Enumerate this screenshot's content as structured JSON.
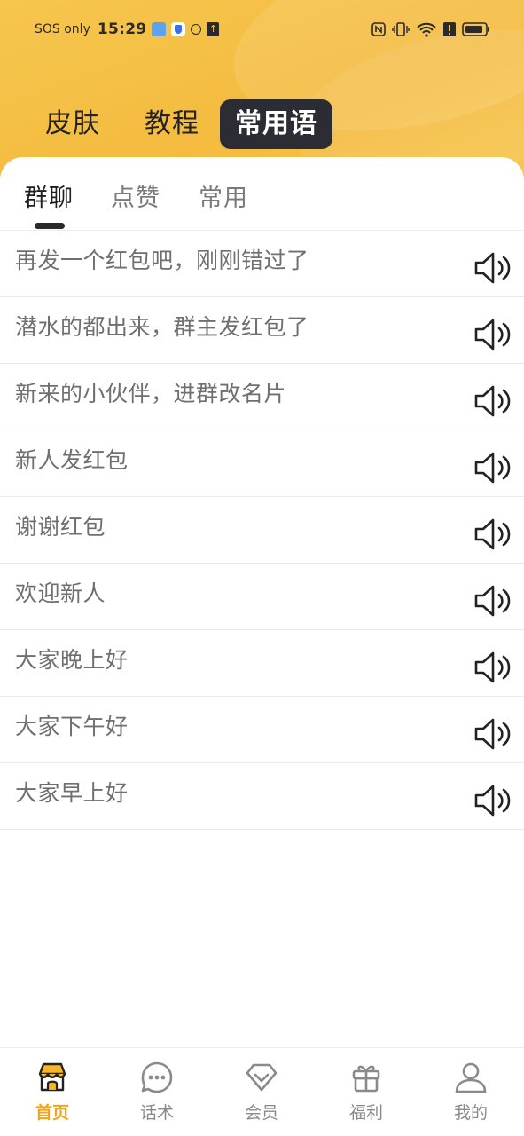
{
  "status_bar": {
    "carrier": "SOS only",
    "time": "15:29"
  },
  "top_tabs": [
    {
      "label": "皮肤"
    },
    {
      "label": "教程"
    },
    {
      "label": "常用语"
    }
  ],
  "active_top_tab": "常用语",
  "sub_tabs": [
    {
      "label": "群聊"
    },
    {
      "label": "点赞"
    },
    {
      "label": "常用"
    }
  ],
  "active_sub_tab": "群聊",
  "phrases": [
    {
      "text": "再发一个红包吧，刚刚错过了",
      "icon": "speaker-icon"
    },
    {
      "text": "潜水的都出来，群主发红包了",
      "icon": "speaker-icon"
    },
    {
      "text": "新来的小伙伴，进群改名片",
      "icon": "speaker-icon"
    },
    {
      "text": "新人发红包",
      "icon": "speaker-icon"
    },
    {
      "text": "谢谢红包",
      "icon": "speaker-icon"
    },
    {
      "text": "欢迎新人",
      "icon": "speaker-icon"
    },
    {
      "text": "大家晚上好",
      "icon": "speaker-icon"
    },
    {
      "text": "大家下午好",
      "icon": "speaker-icon"
    },
    {
      "text": "大家早上好",
      "icon": "speaker-icon"
    }
  ],
  "bottom_nav": [
    {
      "label": "首页",
      "icon": "home-store-icon",
      "active": true
    },
    {
      "label": "话术",
      "icon": "chat-bubble-icon",
      "active": false
    },
    {
      "label": "会员",
      "icon": "diamond-icon",
      "active": false
    },
    {
      "label": "福利",
      "icon": "gift-icon",
      "active": false
    },
    {
      "label": "我的",
      "icon": "profile-icon",
      "active": false
    }
  ],
  "colors": {
    "header_yellow": "#f5c24b",
    "active_tab_bg": "#2c2c34",
    "nav_active": "#f2a516"
  }
}
